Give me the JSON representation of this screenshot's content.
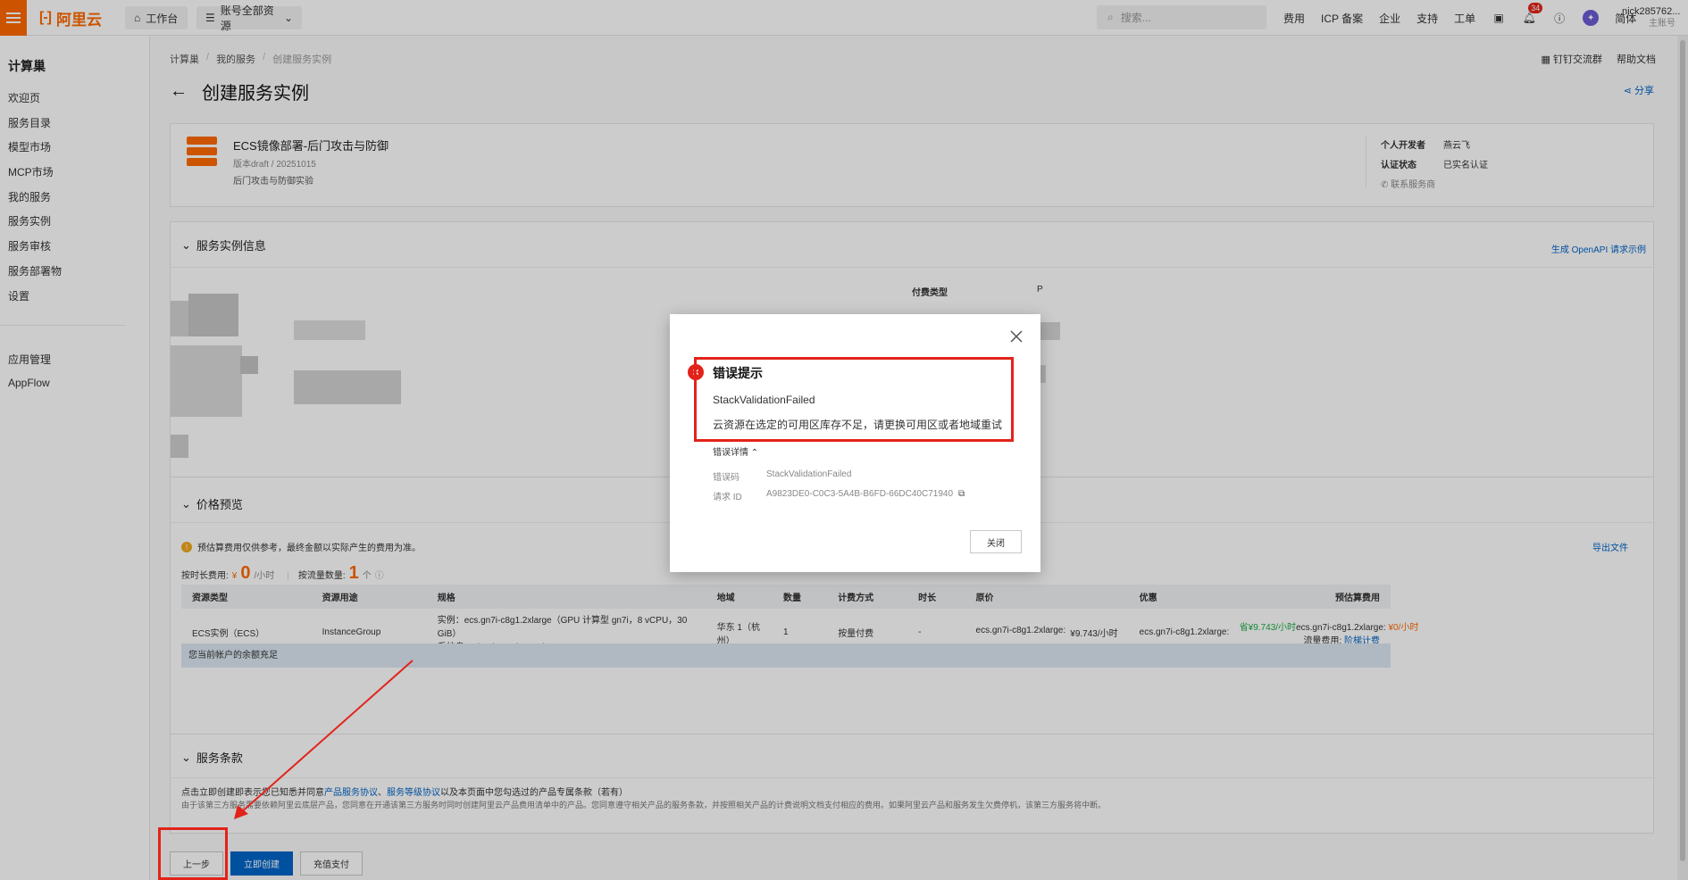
{
  "topbar": {
    "workbench": "工作台",
    "resource_scope": "账号全部资源",
    "search_placeholder": "搜索...",
    "nav": [
      "费用",
      "ICP 备案",
      "企业",
      "支持",
      "工单"
    ],
    "notif_count": "34",
    "lang": "简体",
    "user": "nick285762...",
    "user_role": "主账号",
    "brand": "阿里云",
    "brand_color": "#ff6a00"
  },
  "sidebar": {
    "title": "计算巢",
    "items": [
      "欢迎页",
      "服务目录",
      "模型市场",
      "MCP市场",
      "我的服务",
      "服务实例",
      "服务审核",
      "服务部署物",
      "设置"
    ],
    "items2": [
      "应用管理",
      "AppFlow"
    ]
  },
  "breadcrumb": [
    "计算巢",
    "我的服务",
    "创建服务实例"
  ],
  "tools": [
    "钉钉交流群",
    "帮助文档"
  ],
  "page_title": "创建服务实例",
  "share": "分享",
  "service": {
    "name": "ECS镜像部署-后门攻击与防御",
    "version": "版本draft",
    "date": "20251015",
    "desc": "后门攻击与防御实验",
    "developer_label": "个人开发者",
    "developer": "燕云飞",
    "auth_label": "认证状态",
    "auth_value": "已实名认证",
    "contact": "联系服务商"
  },
  "instance_section": {
    "title": "服务实例信息",
    "openapi": "生成 OpenAPI 请求示例",
    "pay_type_label": "付费类型",
    "pay_type_value": "P"
  },
  "price": {
    "title": "价格预览",
    "notice": "预估算费用仅供参考，最终金额以实际产生的费用为准。",
    "export": "导出文件",
    "hourly_label": "按时长费用:",
    "hourly_symbol": "¥",
    "hourly_value": "0",
    "hourly_unit": "/小时",
    "traffic_label": "按流量数量:",
    "traffic_value": "1",
    "traffic_unit": "个",
    "columns": [
      "资源类型",
      "资源用途",
      "规格",
      "地域",
      "数量",
      "计费方式",
      "时长",
      "原价",
      "优惠",
      "预估算费用"
    ],
    "row": {
      "type": "ECS实例（ECS）",
      "usage": "InstanceGroup",
      "spec1": "实例：ecs.gn7i-c8g1.2xlarge（GPU 计算型 gn7i，8 vCPU，30 GiB）",
      "spec2": "系统盘：cloud_essd 100GiB",
      "region": "华东 1（杭州）",
      "qty": "1",
      "billing": "按量付费",
      "duration": "-",
      "orig_name": "ecs.gn7i-c8g1.2xlarge:",
      "orig_price": "¥9.743/小时",
      "disc_name": "ecs.gn7i-c8g1.2xlarge:",
      "disc_price": "省¥9.743/小时",
      "est_name": "ecs.gn7i-c8g1.2xlarge:",
      "est_price": "¥0/小时",
      "traffic_fee": "流量费用:",
      "tiered": "阶梯计费"
    },
    "balance": "您当前帐户的余额充足"
  },
  "terms": {
    "title": "服务条款",
    "line1_a": "点击立即创建即表示您已知悉并同意",
    "link1": "产品服务协议",
    "sep": "、",
    "link2": "服务等级协议",
    "line1_b": "以及本页面中您勾选过的产品专属条款（若有）",
    "line2": "由于该第三方服务需要依赖阿里云底层产品，您同意在开通该第三方服务时同时创建阿里云产品费用清单中的产品。您同意遵守相关产品的服务条款，并按照相关产品的计费说明文档支付相应的费用。如果阿里云产品和服务发生欠费停机，该第三方服务将中断。"
  },
  "buttons": {
    "prev": "上一步",
    "create": "立即创建",
    "recharge": "充值支付"
  },
  "dialog": {
    "title": "错误提示",
    "code": "StackValidationFailed",
    "message": "云资源在选定的可用区库存不足，请更换可用区或者地域重试",
    "detail_toggle": "错误详情",
    "err_code_label": "错误码",
    "err_code": "StackValidationFailed",
    "req_id_label": "请求 ID",
    "req_id": "A9823DE0-C0C3-5A4B-B6FD-66DC40C71940",
    "close": "关闭"
  }
}
